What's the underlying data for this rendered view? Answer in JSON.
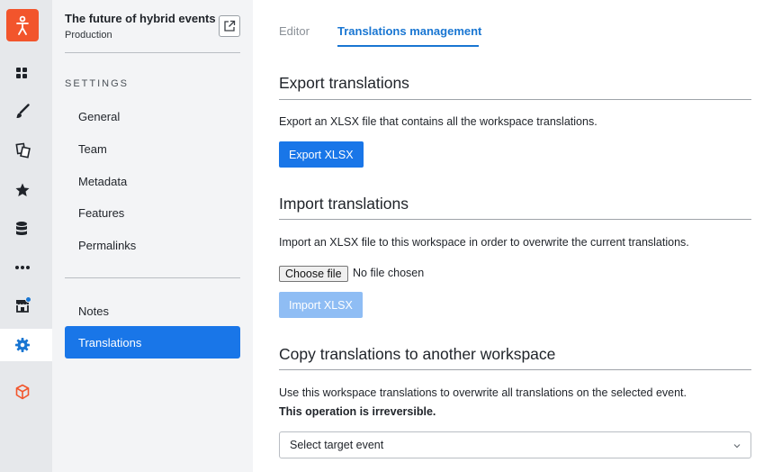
{
  "workspace": {
    "title": "The future of hybrid events",
    "subtitle": "Production"
  },
  "rail": {
    "items": [
      {
        "icon": "grid-icon"
      },
      {
        "icon": "brush-icon"
      },
      {
        "icon": "pages-icon"
      },
      {
        "icon": "star-icon"
      },
      {
        "icon": "database-icon"
      },
      {
        "icon": "more-icon"
      },
      {
        "icon": "store-icon"
      },
      {
        "icon": "gear-icon"
      },
      {
        "icon": "cube-icon"
      }
    ],
    "accent": "#f2552c"
  },
  "settings": {
    "section_label": "SETTINGS",
    "items": [
      "General",
      "Team",
      "Metadata",
      "Features",
      "Permalinks"
    ],
    "extra_items": [
      "Notes",
      "Translations"
    ]
  },
  "tabs": [
    {
      "label": "Editor"
    },
    {
      "label": "Translations management"
    }
  ],
  "export": {
    "title": "Export translations",
    "description": "Export an XLSX file that contains all the workspace translations.",
    "button": "Export XLSX"
  },
  "import": {
    "title": "Import translations",
    "description": "Import an XLSX file to this workspace in order to overwrite the current translations.",
    "choose_file": "Choose file",
    "no_file": "No file chosen",
    "button": "Import XLSX"
  },
  "copy": {
    "title": "Copy translations to another workspace",
    "description": "Use this workspace translations to overwrite all translations on the selected event.",
    "warning": "This operation is irreversible.",
    "select_placeholder": "Select target event"
  },
  "colors": {
    "primary": "#1976e8",
    "primary_disabled": "#8fbdf4",
    "rail_bg": "#e6e8eb",
    "panel_bg": "#f3f4f6"
  }
}
